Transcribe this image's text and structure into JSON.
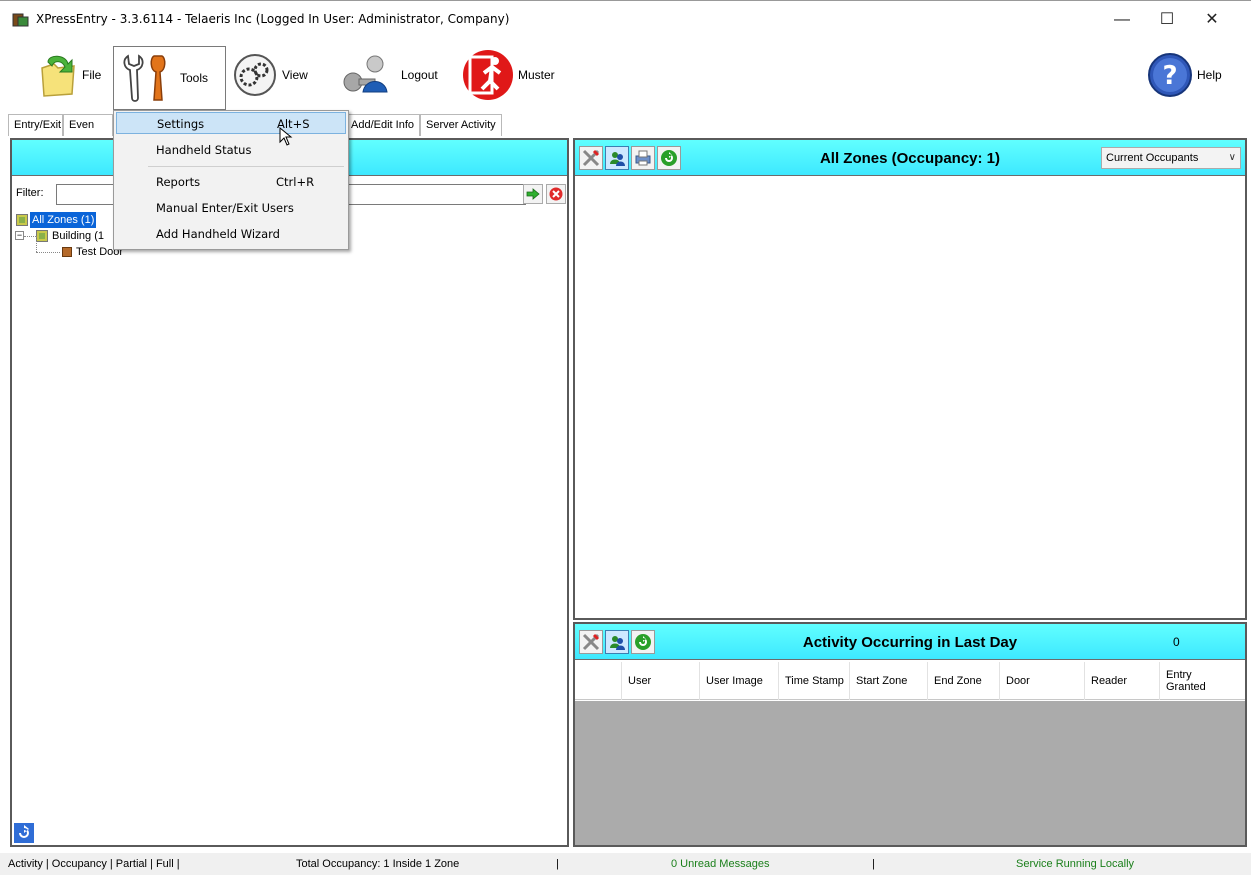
{
  "window": {
    "title": "XPressEntry - 3.3.6114 - Telaeris Inc (Logged In User: Administrator, Company)",
    "minimize": "—",
    "maximize": "☐",
    "close": "✕"
  },
  "toolbar": {
    "file": "File",
    "tools": "Tools",
    "view": "View",
    "logout": "Logout",
    "muster": "Muster",
    "help": "Help"
  },
  "tabs": [
    "Entry/Exit",
    "Even",
    "Add/Edit Info",
    "Server Activity"
  ],
  "left_panel": {
    "filter_label": "Filter:",
    "filter_value": "",
    "tree": [
      {
        "label": "All Zones (1)",
        "selected": true
      },
      {
        "label": "Building (1",
        "selected": false
      },
      {
        "label": "Test Door",
        "selected": false
      }
    ]
  },
  "occupancy_panel": {
    "title": "All Zones (Occupancy: 1)",
    "dropdown_value": "Current Occupants"
  },
  "activity_panel": {
    "title": "Activity Occurring in Last Day",
    "count": "0",
    "columns": [
      "User",
      "User Image",
      "Time Stamp",
      "Start Zone",
      "End Zone",
      "Door",
      "Reader",
      "Entry Granted"
    ]
  },
  "tools_menu": {
    "items": [
      {
        "label": "Settings",
        "shortcut": "Alt+S"
      },
      {
        "label": "Handheld Status",
        "shortcut": ""
      },
      {
        "label": "Reports",
        "shortcut": "Ctrl+R"
      },
      {
        "label": "Manual Enter/Exit Users",
        "shortcut": ""
      },
      {
        "label": "Add Handheld Wizard",
        "shortcut": ""
      }
    ]
  },
  "statusbar": {
    "modes": "Activity | Occupancy | Partial | Full |",
    "total_occupancy": "Total Occupancy: 1 Inside 1 Zone",
    "sep1": "|",
    "messages": "0 Unread Messages",
    "sep2": "|",
    "service": "Service Running Locally"
  },
  "colors": {
    "panel_header": "#3ee8ff",
    "status_green": "#1a7f1a",
    "selection": "#0a64d8"
  }
}
